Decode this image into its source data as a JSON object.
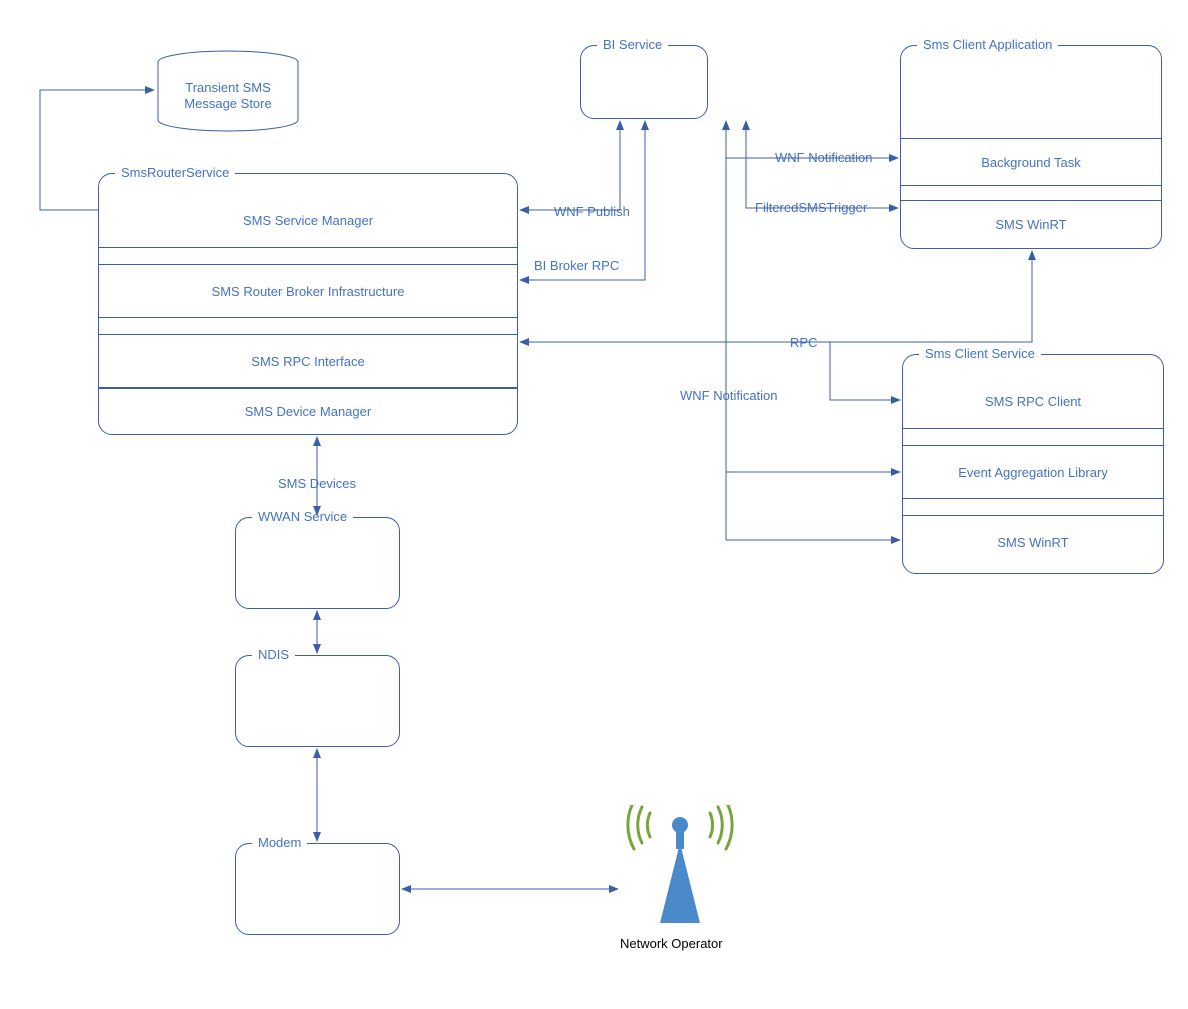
{
  "nodes": {
    "transientStore": "Transient SMS\nMessage Store",
    "smsRouterService": "SmsRouterService",
    "smsServiceManager": "SMS Service Manager",
    "smsRouterBroker": "SMS Router Broker Infrastructure",
    "smsRpcInterface": "SMS RPC Interface",
    "smsDeviceManager": "SMS Device Manager",
    "biService": "BI Service",
    "smsClientApp": "Sms Client Application",
    "backgroundTask": "Background Task",
    "smsWinRT1": "SMS WinRT",
    "smsClientService": "Sms Client Service",
    "smsRpcClient": "SMS RPC Client",
    "eventAggregation": "Event Aggregation Library",
    "smsWinRT2": "SMS WinRT",
    "wwanService": "WWAN Service",
    "ndis": "NDIS",
    "modem": "Modem",
    "networkOperator": "Network Operator"
  },
  "edges": {
    "smsDevices": "SMS Devices",
    "wnfPublish": "WNF Publish",
    "biBrokerRpc": "BI Broker RPC",
    "wnfNotification1": "WNF Notification",
    "filteredSmsTrigger": "FilteredSMSTrigger",
    "wnfNotification2": "WNF Notification",
    "rpc": "RPC"
  }
}
